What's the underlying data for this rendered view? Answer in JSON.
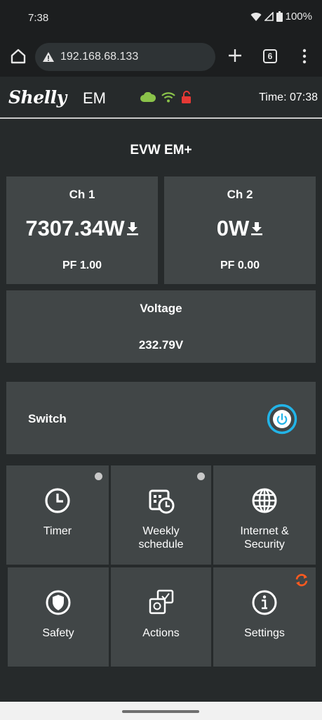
{
  "status_bar": {
    "time": "7:38",
    "battery": "100%"
  },
  "browser": {
    "url": "192.168.68.133",
    "tab_count": "6"
  },
  "app_header": {
    "logo_text": "Shelly",
    "logo_suffix": "EM",
    "time": "Time: 07:38"
  },
  "device": {
    "title": "EVW EM+"
  },
  "channels": [
    {
      "label": "Ch 1",
      "power": "7307.34W",
      "pf": "PF 1.00"
    },
    {
      "label": "Ch 2",
      "power": "0W",
      "pf": "PF 0.00"
    }
  ],
  "voltage": {
    "label": "Voltage",
    "value": "232.79V"
  },
  "switch": {
    "label": "Switch"
  },
  "tiles": {
    "timer": "Timer",
    "weekly_schedule": [
      "Weekly",
      "schedule"
    ],
    "internet_security": [
      "Internet &",
      "Security"
    ],
    "safety": "Safety",
    "actions": "Actions",
    "settings": "Settings"
  },
  "colors": {
    "accent_blue": "#22b4e8",
    "cloud_green": "#8bc34a",
    "lock_red": "#e53935",
    "update_orange": "#ff5a1f"
  }
}
